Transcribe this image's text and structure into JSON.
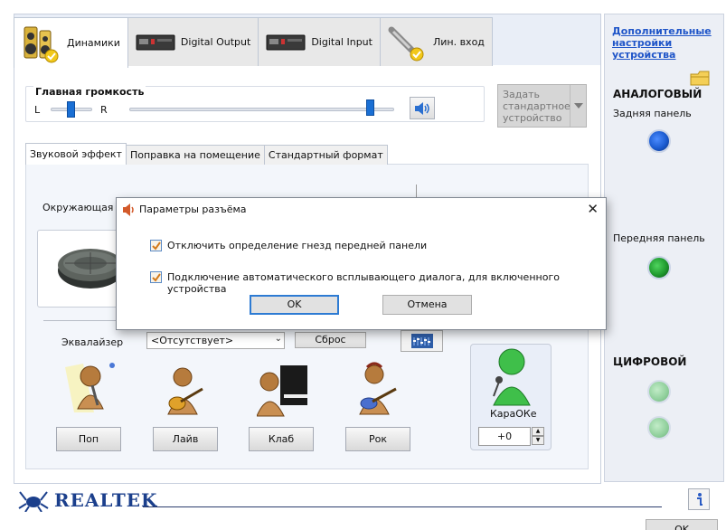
{
  "tabs": [
    {
      "label": "Динамики",
      "icon": "speakers-icon"
    },
    {
      "label": "Digital Output",
      "icon": "digital-output-icon"
    },
    {
      "label": "Digital Input",
      "icon": "digital-input-icon"
    },
    {
      "label": "Лин. вход",
      "icon": "line-in-icon"
    }
  ],
  "volume": {
    "title": "Главная громкость",
    "left_label": "L",
    "right_label": "R",
    "balance": 0.5,
    "level": 0.91
  },
  "std_device": {
    "label": "Задать стандартное устройство"
  },
  "sub_tabs": [
    "Звуковой эффект",
    "Поправка на помещение",
    "Стандартный формат"
  ],
  "effect": {
    "surround_label": "Окружающая об"
  },
  "equalizer": {
    "label": "Эквалайзер",
    "selected": "<Отсутствует>",
    "reset_label": "Сброс"
  },
  "presets": [
    "Поп",
    "Лайв",
    "Клаб",
    "Рок"
  ],
  "karaoke": {
    "label": "КараОКе",
    "value": "+0"
  },
  "side": {
    "advanced_link": "Дополнительные настройки устройства",
    "analog_title": "АНАЛОГОВЫЙ",
    "rear_panel": "Задняя панель",
    "front_panel": "Передняя панель",
    "digital_title": "ЦИФРОВОЙ"
  },
  "dialog": {
    "title": "Параметры разъёма",
    "option1": "Отключить определение гнезд передней панели",
    "option2": "Подключение автоматического всплывающего диалога, для включенного устройства",
    "option1_checked": true,
    "option2_checked": true,
    "ok_label": "OK",
    "cancel_label": "Отмена"
  },
  "footer": {
    "brand": "REALTEK",
    "ok_label": "OK"
  },
  "colors": {
    "accent": "#1a6fd4",
    "link": "#1f55c8",
    "jack_blue": "#1b5bd0",
    "jack_green": "#1f9a2e",
    "jack_inactive": "#9fcfaa"
  }
}
